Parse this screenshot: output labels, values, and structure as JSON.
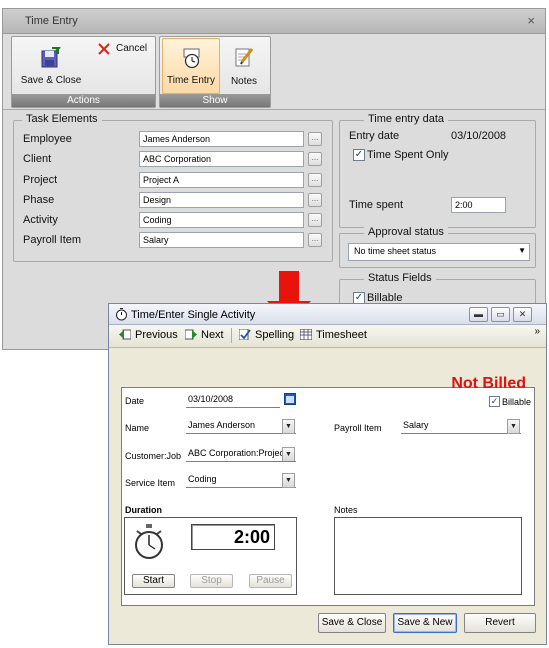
{
  "time_entry": {
    "title": "Time Entry",
    "close_glyph": "×",
    "ribbon": {
      "save_close": "Save & Close",
      "cancel": "Cancel",
      "actions_group": "Actions",
      "time_entry": "Time Entry",
      "notes": "Notes",
      "show_group": "Show"
    },
    "task_elements": {
      "legend": "Task Elements",
      "rows": [
        {
          "label": "Employee",
          "value": "James Anderson"
        },
        {
          "label": "Client",
          "value": "ABC Corporation"
        },
        {
          "label": "Project",
          "value": "Project A"
        },
        {
          "label": "Phase",
          "value": "Design"
        },
        {
          "label": "Activity",
          "value": "Coding"
        },
        {
          "label": "Payroll Item",
          "value": "Salary"
        }
      ],
      "dots_glyph": "..."
    },
    "time_entry_data": {
      "legend": "Time entry data",
      "entry_date_label": "Entry date",
      "entry_date_value": "03/10/2008",
      "time_spent_only": "Time Spent Only",
      "time_spent_label": "Time spent",
      "time_spent_value": "2:00"
    },
    "approval": {
      "legend": "Approval status",
      "value": "No time sheet status"
    },
    "status_fields": {
      "legend": "Status Fields",
      "billable": "Billable"
    }
  },
  "arrow_color": "#e8140c",
  "single_activity": {
    "title": "Time/Enter Single Activity",
    "window_buttons": {
      "minimize": "▬",
      "restore": "▭",
      "close": "✕"
    },
    "toolbar": {
      "previous": "Previous",
      "next": "Next",
      "spelling": "Spelling",
      "timesheet": "Timesheet",
      "overflow": "»"
    },
    "form": {
      "status": "Not Billed",
      "status_color": "#e0100c",
      "billable": "Billable",
      "date_label": "Date",
      "date_value": "03/10/2008",
      "name_label": "Name",
      "name_value": "James Anderson",
      "customer_label": "Customer:Job",
      "customer_value": "ABC Corporation:Project A",
      "service_label": "Service Item",
      "service_value": "Coding",
      "payroll_label": "Payroll Item",
      "payroll_value": "Salary",
      "duration_label": "Duration",
      "duration_value": "2:00",
      "notes_label": "Notes",
      "start": "Start",
      "stop": "Stop",
      "pause": "Pause",
      "dropdown_glyph": "▼"
    },
    "footer": {
      "save_close": "Save & Close",
      "save_new": "Save & New",
      "revert": "Revert"
    }
  }
}
